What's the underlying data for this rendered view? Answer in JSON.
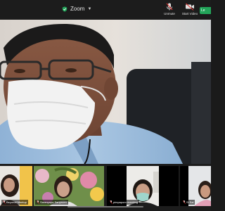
{
  "header": {
    "app_title": "Zoom",
    "buttons": [
      {
        "label": "Unmute",
        "icon": "mic-off-icon"
      },
      {
        "label": "Start Video",
        "icon": "video-off-icon"
      }
    ],
    "leave_label": "Le"
  },
  "colors": {
    "accent_green": "#23a55a",
    "bar_bg": "#1c1c1c"
  },
  "participants": [
    {
      "name": "Beyonal Meetup"
    },
    {
      "name": "Saranyapa Sanpruen"
    },
    {
      "name": "pimpaporn manking"
    },
    {
      "name": "Si Sai"
    }
  ]
}
